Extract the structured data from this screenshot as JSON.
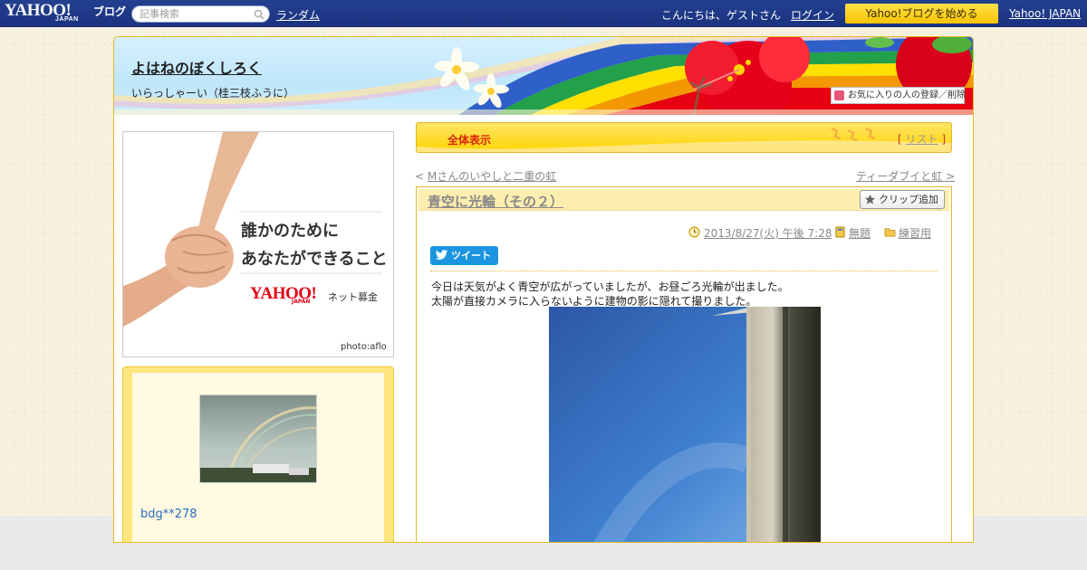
{
  "topbar": {
    "logo_text": "YAHOO!",
    "logo_sub": "JAPAN",
    "logo_blog": "ブログ",
    "search_placeholder": "記事検索",
    "random_link": "ランダム",
    "greeting": "こんにちは、ゲストさん",
    "login_link": "ログイン",
    "start_blog_button": "Yahoo!ブログを始める",
    "yahoo_japan_link": "Yahoo! JAPAN"
  },
  "header": {
    "blog_title": "よはねのぼくしろく",
    "blog_subtitle": "いらっしゃーい（桂三枝ふうに）",
    "favorite_button": "お気に入りの人の登録／削除"
  },
  "ad": {
    "line1": "誰かのために",
    "line2": "あなたができること",
    "logo": "YAHOO!",
    "logo_sub": "JAPAN",
    "bokin": "ネット募金",
    "credit": "photo:aflo"
  },
  "profile": {
    "name": "bdg**278"
  },
  "view_bar": {
    "view_all": "全体表示",
    "list_open": "[",
    "list_link": "リスト",
    "list_close": "]"
  },
  "nav": {
    "prev_marker": "<",
    "prev_title": "Mさんのいやしと二重の虹",
    "next_title": "ティーダブイと虹",
    "next_marker": ">"
  },
  "article": {
    "title": "青空に光輪（その２）",
    "clip_button": "クリップ追加",
    "date": "2013/8/27(火) 午後 7:28",
    "theme": "無題",
    "category": "練習用",
    "tweet_button": "ツイート",
    "body": [
      "今日は天気がよく青空が広がっていましたが、お昼ごろ光輪が出ました。",
      "太陽が直接カメラに入らないように建物の影に隠れて撮りました。"
    ]
  },
  "colors": {
    "topbar": "#1f3a8a",
    "accent_yellow": "#ffd400",
    "frame_border": "#e6b72a",
    "view_all_red": "#d9230b",
    "tweet_blue": "#1b95e0",
    "profile_link": "#2a6dbf"
  }
}
